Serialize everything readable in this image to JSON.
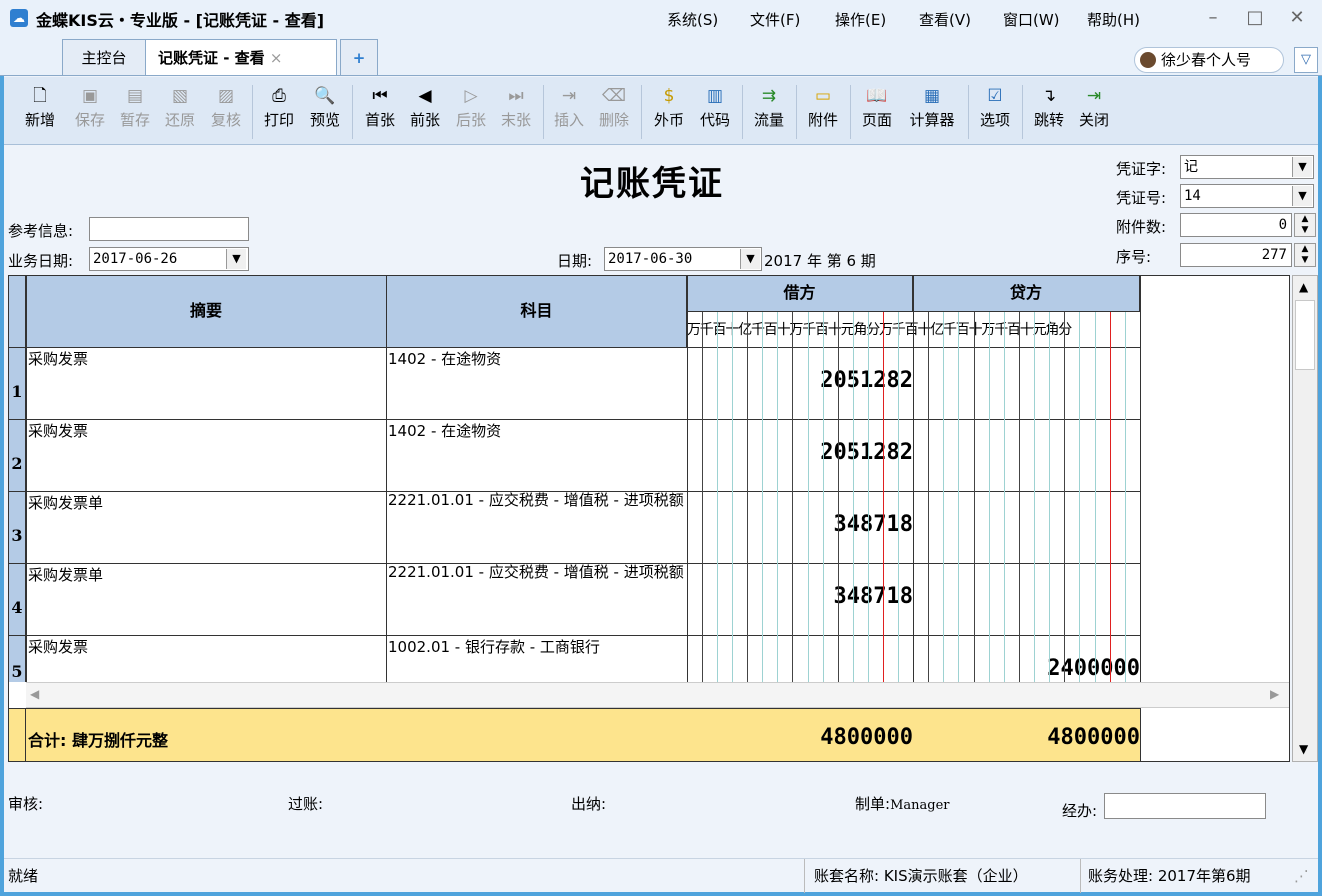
{
  "window": {
    "title": "金蝶KIS云・专业版 - [记账凭证 - 查看]",
    "app_icon": "cloud-icon"
  },
  "menu": [
    "系统(S)",
    "文件(F)",
    "操作(E)",
    "查看(V)",
    "窗口(W)",
    "帮助(H)"
  ],
  "tabs": [
    {
      "label": "主控台"
    },
    {
      "label": "记账凭证 - 查看",
      "close": "×"
    }
  ],
  "tab_add": "+",
  "user": {
    "name": "徐少春个人号"
  },
  "toolbar": [
    {
      "label": "新增",
      "icon": "new-icon",
      "enabled": true
    },
    {
      "label": "保存",
      "icon": "save-icon",
      "enabled": false
    },
    {
      "label": "暂存",
      "icon": "temp-save-icon",
      "enabled": false
    },
    {
      "label": "还原",
      "icon": "restore-icon",
      "enabled": false
    },
    {
      "label": "复核",
      "icon": "review-icon",
      "enabled": false
    },
    {
      "label": "打印",
      "icon": "print-icon",
      "enabled": true
    },
    {
      "label": "预览",
      "icon": "preview-icon",
      "enabled": true
    },
    {
      "label": "首张",
      "icon": "first-icon",
      "enabled": true
    },
    {
      "label": "前张",
      "icon": "prev-icon",
      "enabled": true
    },
    {
      "label": "后张",
      "icon": "next-icon",
      "enabled": false
    },
    {
      "label": "末张",
      "icon": "last-icon",
      "enabled": false
    },
    {
      "label": "插入",
      "icon": "insert-icon",
      "enabled": false
    },
    {
      "label": "删除",
      "icon": "delete-icon",
      "enabled": false
    },
    {
      "label": "外币",
      "icon": "currency-icon",
      "enabled": true
    },
    {
      "label": "代码",
      "icon": "code-icon",
      "enabled": true
    },
    {
      "label": "流量",
      "icon": "flow-icon",
      "enabled": true
    },
    {
      "label": "附件",
      "icon": "attachment-icon",
      "enabled": true
    },
    {
      "label": "页面",
      "icon": "page-icon",
      "enabled": true
    },
    {
      "label": "计算器",
      "icon": "calculator-icon",
      "enabled": true
    },
    {
      "label": "选项",
      "icon": "options-icon",
      "enabled": true
    },
    {
      "label": "跳转",
      "icon": "jump-icon",
      "enabled": true
    },
    {
      "label": "关闭",
      "icon": "close-icon",
      "enabled": true
    }
  ],
  "voucher": {
    "title": "记账凭证",
    "ref_info_label": "参考信息:",
    "ref_info_value": "",
    "biz_date_label": "业务日期:",
    "biz_date": "2017-06-26",
    "date_label": "日期:",
    "date": "2017-06-30",
    "period": "2017 年 第 6 期",
    "word_label": "凭证字:",
    "word": "记",
    "number_label": "凭证号:",
    "number": "14",
    "attach_label": "附件数:",
    "attach": "0",
    "seq_label": "序号:",
    "seq": "277"
  },
  "grid": {
    "headers": {
      "summary": "摘要",
      "account": "科目",
      "debit": "借方",
      "credit": "贷方",
      "digits": "万千百十亿千百十万千百十元角分"
    },
    "rows": [
      {
        "no": "1",
        "summary": "采购发票",
        "account": "1402 - 在途物资",
        "debit": "2051282",
        "credit": ""
      },
      {
        "no": "2",
        "summary": "采购发票",
        "account": "1402 - 在途物资",
        "debit": "2051282",
        "credit": ""
      },
      {
        "no": "3",
        "summary": "采购发票单",
        "account": "2221.01.01 - 应交税费 - 增值税 - 进项税额",
        "debit": "348718",
        "credit": ""
      },
      {
        "no": "4",
        "summary": "采购发票单",
        "account": "2221.01.01 - 应交税费 - 增值税 - 进项税额",
        "debit": "348718",
        "credit": ""
      },
      {
        "no": "5",
        "summary": "采购发票",
        "account": "1002.01 - 银行存款 - 工商银行",
        "debit": "",
        "credit": "2400000"
      }
    ],
    "total": {
      "label": "合计: 肆万捌仟元整",
      "debit": "4800000",
      "credit": "4800000"
    }
  },
  "footer": {
    "review": "审核:",
    "post": "过账:",
    "cashier": "出纳:",
    "maker_label": "制单:",
    "maker": "Manager",
    "handler": "经办:"
  },
  "status": {
    "left": "就绪",
    "account_set": "账套名称: KIS演示账套（企业）",
    "processing": "账务处理: 2017年第6期"
  },
  "colors": {
    "header_blue": "#b4cbe6",
    "total_yellow": "#fde48d",
    "red_line": "#e02020"
  }
}
